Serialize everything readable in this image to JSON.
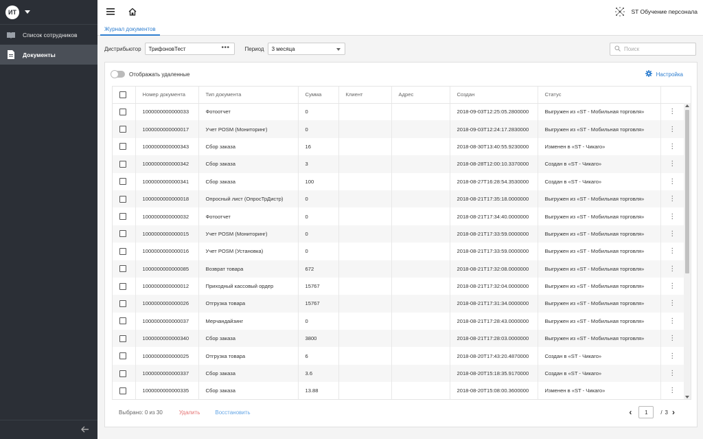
{
  "sidebar": {
    "avatar_initials": "ИТ",
    "items": [
      {
        "label": "Список сотрудников",
        "icon": "book-icon",
        "active": false
      },
      {
        "label": "Документы",
        "icon": "document-icon",
        "active": true
      }
    ]
  },
  "header": {
    "brand": "ST Обучение персонала"
  },
  "tabs": [
    {
      "label": "Журнал документов",
      "active": true
    }
  ],
  "filters": {
    "distributor_label": "Дистрибьютор",
    "distributor_value": "ТрифоновТест",
    "period_label": "Период",
    "period_value": "3 месяца",
    "search_placeholder": "Поиск"
  },
  "card": {
    "toggle_label": "Отображать удаленные",
    "settings_label": "Настройка"
  },
  "table": {
    "columns": [
      "Номер документа",
      "Тип документа",
      "Сумма",
      "Клиент",
      "Адрес",
      "Создан",
      "Статус"
    ],
    "rows": [
      [
        "1000000000000033",
        "Фотоотчет",
        "0",
        "",
        "",
        "2018-09-03T12:25:05.2800000",
        "Выгружен из «ST - Мобильная торговля»"
      ],
      [
        "1000000000000017",
        "Учет POSM (Мониторинг)",
        "0",
        "",
        "",
        "2018-09-03T12:24:17.2830000",
        "Выгружен из «ST - Мобильная торговля»"
      ],
      [
        "1000000000000343",
        "Сбор заказа",
        "16",
        "",
        "",
        "2018-08-30T13:40:55.9230000",
        "Изменен в «ST - Чикаго»"
      ],
      [
        "1000000000000342",
        "Сбор заказа",
        "3",
        "",
        "",
        "2018-08-28T12:00:10.3370000",
        "Создан в «ST - Чикаго»"
      ],
      [
        "1000000000000341",
        "Сбор заказа",
        "100",
        "",
        "",
        "2018-08-27T16:28:54.3530000",
        "Создан в «ST - Чикаго»"
      ],
      [
        "1000000000000018",
        "Опросный лист (ОпросТрДистр)",
        "0",
        "",
        "",
        "2018-08-21T17:35:18.0000000",
        "Выгружен из «ST - Мобильная торговля»"
      ],
      [
        "1000000000000032",
        "Фотоотчет",
        "0",
        "",
        "",
        "2018-08-21T17:34:40.0000000",
        "Выгружен из «ST - Мобильная торговля»"
      ],
      [
        "1000000000000015",
        "Учет POSM (Мониторинг)",
        "0",
        "",
        "",
        "2018-08-21T17:33:59.0000000",
        "Выгружен из «ST - Мобильная торговля»"
      ],
      [
        "1000000000000016",
        "Учет POSM (Установка)",
        "0",
        "",
        "",
        "2018-08-21T17:33:59.0000000",
        "Выгружен из «ST - Мобильная торговля»"
      ],
      [
        "1000000000000085",
        "Возврат товара",
        "672",
        "",
        "",
        "2018-08-21T17:32:08.0000000",
        "Выгружен из «ST - Мобильная торговля»"
      ],
      [
        "1000000000000012",
        "Приходный кассовый ордер",
        "15767",
        "",
        "",
        "2018-08-21T17:32:04.0000000",
        "Выгружен из «ST - Мобильная торговля»"
      ],
      [
        "1000000000000026",
        "Отгрузка товара",
        "15767",
        "",
        "",
        "2018-08-21T17:31:34.0000000",
        "Выгружен из «ST - Мобильная торговля»"
      ],
      [
        "1000000000000037",
        "Мерчандайзинг",
        "0",
        "",
        "",
        "2018-08-21T17:28:43.0000000",
        "Выгружен из «ST - Мобильная торговля»"
      ],
      [
        "1000000000000340",
        "Сбор заказа",
        "3800",
        "",
        "",
        "2018-08-21T17:28:03.0000000",
        "Выгружен из «ST - Мобильная торговля»"
      ],
      [
        "1000000000000025",
        "Отгрузка товара",
        "6",
        "",
        "",
        "2018-08-20T17:43:20.4870000",
        "Создан в «ST - Чикаго»"
      ],
      [
        "1000000000000337",
        "Сбор заказа",
        "3.6",
        "",
        "",
        "2018-08-20T15:18:35.9170000",
        "Создан в «ST - Чикаго»"
      ],
      [
        "1000000000000335",
        "Сбор заказа",
        "13.88",
        "",
        "",
        "2018-08-20T15:08:00.3600000",
        "Изменен в «ST - Чикаго»"
      ]
    ]
  },
  "footer": {
    "selected": "Выбрано: 0 из 30",
    "delete_label": "Удалить",
    "restore_label": "Восстановить",
    "page_current": "1",
    "page_sep": "/",
    "page_total": "3"
  },
  "colors": {
    "sidebar_bg": "#2b2f36",
    "accent": "#2f7fd0",
    "delete": "#e57373",
    "restore": "#64a6e6"
  }
}
